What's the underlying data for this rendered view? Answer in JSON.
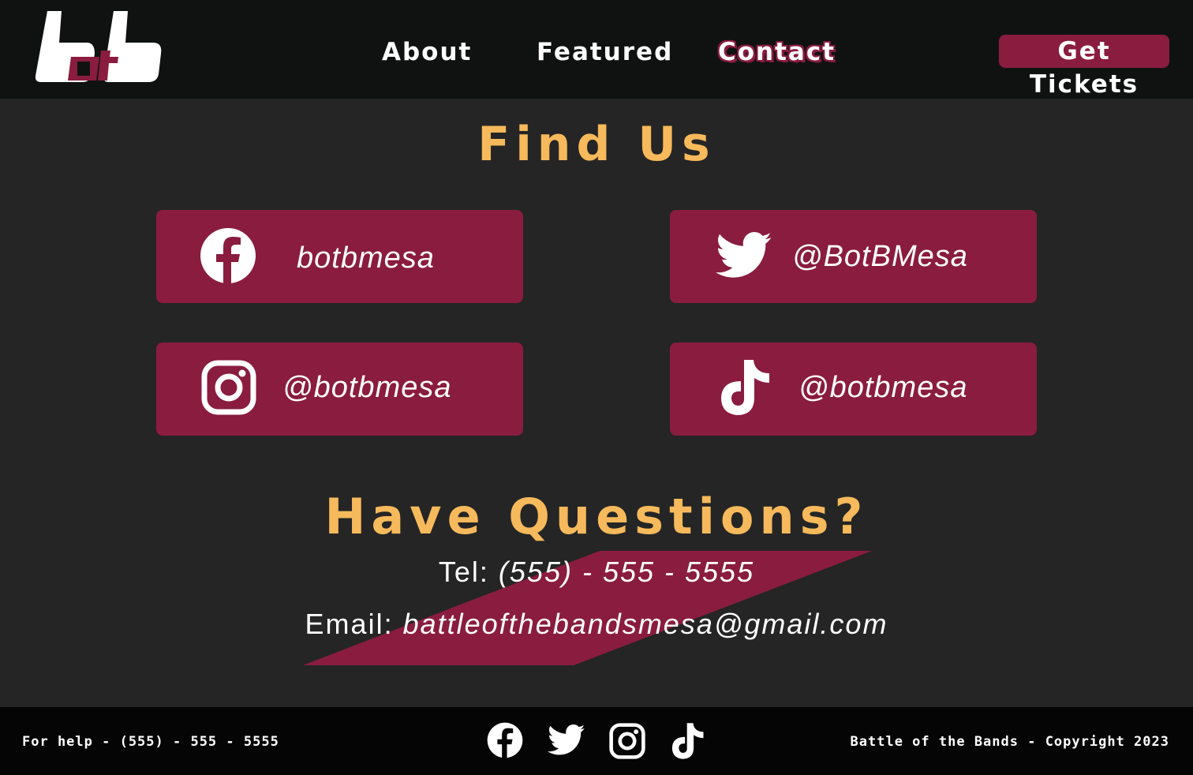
{
  "header": {
    "logo_text": "bbbt",
    "nav": [
      "About",
      "Featured",
      "Contact"
    ],
    "active_nav": "Contact",
    "cta_label": "Get Tickets"
  },
  "find_us": {
    "title": "Find Us",
    "socials": [
      {
        "platform": "facebook",
        "icon": "facebook-icon",
        "handle": "botbmesa"
      },
      {
        "platform": "twitter",
        "icon": "twitter-icon",
        "handle": "@BotBMesa"
      },
      {
        "platform": "instagram",
        "icon": "instagram-icon",
        "handle": "@botbmesa"
      },
      {
        "platform": "tiktok",
        "icon": "tiktok-icon",
        "handle": "@botbmesa"
      }
    ]
  },
  "questions": {
    "title": "Have Questions?",
    "tel_label": "Tel:",
    "tel_value": "(555) - 555 - 5555",
    "email_label": "Email:",
    "email_value": "battleofthebandsmesa@gmail.com"
  },
  "footer": {
    "help_text": "For help - (555) - 555 - 5555",
    "copyright": "Battle of the Bands - Copyright 2023",
    "icons": [
      "facebook-icon",
      "twitter-icon",
      "instagram-icon",
      "tiktok-icon"
    ]
  },
  "colors": {
    "accent": "#8a1c40",
    "heading": "#f6b95b",
    "background": "#252525",
    "header_bg": "#101212",
    "footer_bg": "#050505"
  }
}
